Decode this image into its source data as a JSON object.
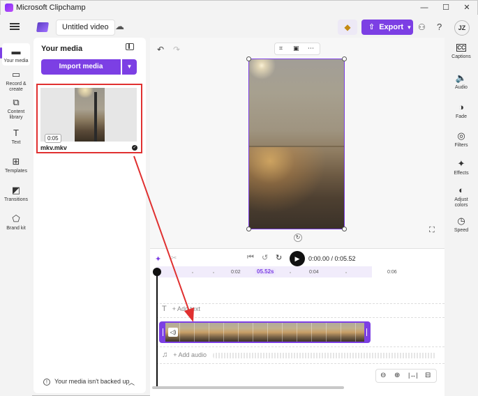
{
  "window": {
    "title": "Microsoft Clipchamp",
    "minimize": "—",
    "maximize": "☐",
    "close": "✕"
  },
  "header": {
    "project_title": "Untitled video",
    "export_label": "Export",
    "avatar_initials": "JZ"
  },
  "left_rail": [
    {
      "label": "Your media",
      "icon": "folder-icon",
      "glyph": "▬"
    },
    {
      "label": "Record & create",
      "icon": "camera-icon",
      "glyph": "▭"
    },
    {
      "label": "Content library",
      "icon": "library-icon",
      "glyph": "⧉"
    },
    {
      "label": "Text",
      "icon": "text-icon",
      "glyph": "T"
    },
    {
      "label": "Templates",
      "icon": "templates-icon",
      "glyph": "⊞"
    },
    {
      "label": "Transitions",
      "icon": "transitions-icon",
      "glyph": "◩"
    },
    {
      "label": "Brand kit",
      "icon": "brand-kit-icon",
      "glyph": "⬠"
    }
  ],
  "media_panel": {
    "title": "Your media",
    "import_label": "Import media",
    "item": {
      "duration": "0:05",
      "filename": "mkv.mkv"
    },
    "backup_note": "Your media isn't backed up"
  },
  "right_rail": [
    {
      "label": "Captions",
      "icon": "captions-icon",
      "glyph": "CC"
    },
    {
      "label": "Audio",
      "icon": "speaker-icon",
      "glyph": "🔈"
    },
    {
      "label": "Fade",
      "icon": "fade-icon",
      "glyph": "◑"
    },
    {
      "label": "Filters",
      "icon": "filters-icon",
      "glyph": "◎"
    },
    {
      "label": "Effects",
      "icon": "effects-icon",
      "glyph": "✦"
    },
    {
      "label": "Adjust colors",
      "icon": "adjust-colors-icon",
      "glyph": "◐"
    },
    {
      "label": "Speed",
      "icon": "speed-icon",
      "glyph": "◷"
    }
  ],
  "timeline": {
    "timecode": "0:00.00 / 0:05.52",
    "ticks": {
      "t1": "0:02",
      "t2": "05.52s",
      "t3": "0:04",
      "t4": "0:06"
    },
    "add_text": "+ Add text",
    "add_audio": "+ Add audio"
  },
  "colors": {
    "accent": "#7c3fe4",
    "annotation": "#e03030"
  }
}
